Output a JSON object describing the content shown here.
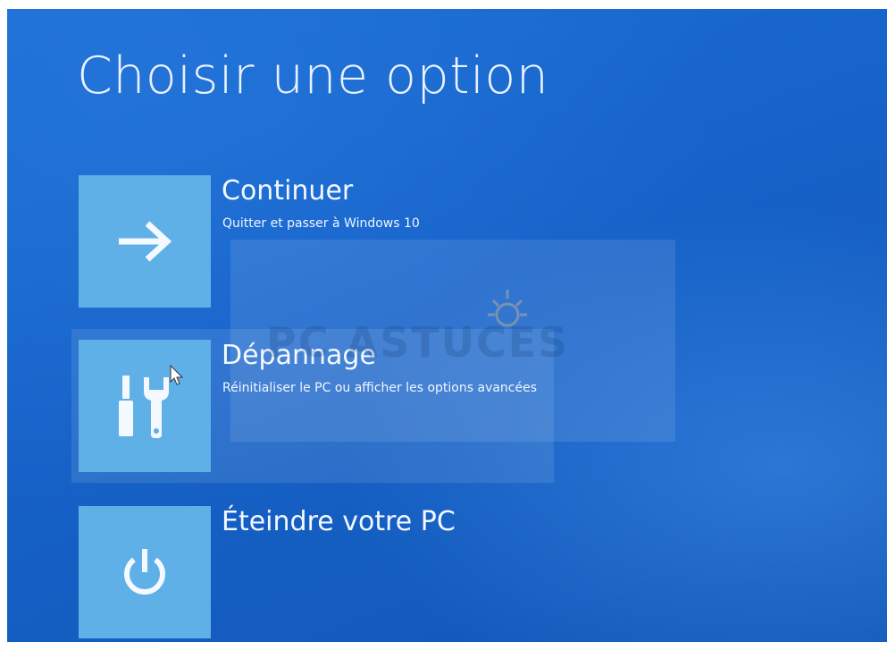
{
  "screen": {
    "title": "Choisir une option"
  },
  "options": [
    {
      "title": "Continuer",
      "description": "Quitter et passer à Windows 10",
      "icon": "arrow-right-icon"
    },
    {
      "title": "Dépannage",
      "description": "Réinitialiser le PC ou afficher les options avancées",
      "icon": "tools-icon"
    },
    {
      "title": "Éteindre votre PC",
      "description": "",
      "icon": "power-icon"
    }
  ],
  "watermark": {
    "text": "PC ASTUCES"
  },
  "colors": {
    "background": "#1662c8",
    "tile": "#5fb0e6",
    "text": "#f2f8ff"
  }
}
